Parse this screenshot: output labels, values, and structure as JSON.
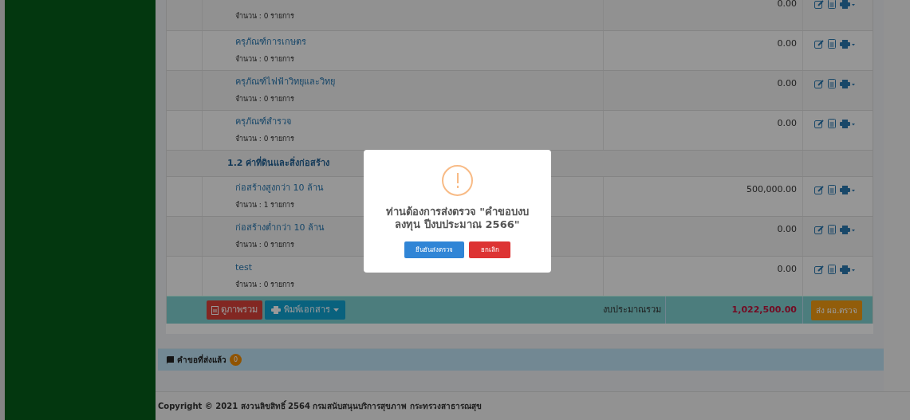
{
  "rows": [
    {
      "kind": "item",
      "count": "จำนวน : 0 รายการ",
      "amount": "0.00"
    },
    {
      "kind": "item",
      "title": "ครุภัณฑ์การเกษตร",
      "count": "จำนวน : 0 รายการ",
      "amount": "0.00"
    },
    {
      "kind": "item",
      "title": "ครุภัณฑ์ไฟฟ้าวิทยุและวิทยุ",
      "count": "จำนวน : 0 รายการ",
      "amount": "0.00"
    },
    {
      "kind": "item",
      "title": "ครุภัณฑ์สำรวจ",
      "count": "จำนวน : 0 รายการ",
      "amount": "0.00"
    },
    {
      "kind": "section",
      "title": "1.2 ค่าที่ดินและสิ่งก่อสร้าง"
    },
    {
      "kind": "item",
      "title": "ก่อสร้างสูงกว่า 10 ล้าน",
      "count": "จำนวน : 1 รายการ",
      "amount": "500,000.00"
    },
    {
      "kind": "item",
      "title": "ก่อสร้างต่ำกว่า 10 ล้าน",
      "count": "จำนวน : 0 รายการ",
      "amount": "0.00"
    },
    {
      "kind": "item",
      "title": "test",
      "count": "จำนวน : 0 รายการ",
      "amount": "0.00"
    }
  ],
  "total": {
    "overview_button": "ดูภาพรวม",
    "print_button": "พิมพ์เอกสาร",
    "label": "งบประมาณรวม",
    "amount": "1,022,500.00",
    "send_button": "ส่ง ผอ.ตรวจ"
  },
  "sent_panel": {
    "title": "คำขอที่ส่งแล้ว",
    "badge": "0"
  },
  "footer": {
    "text": "Copyright © 2021 **สงวนลิขสิทธิ์** 2564 **กรมสนับสนุนบริการสุขภาพ กระทรวงสาธารณสุข**"
  },
  "dialog": {
    "message": "ท่านต้องการส่งตรวจ \"คำขอบงบลงทุน ปีงบประมาณ 2566\"",
    "confirm": "ยืนยันส่งตรวจ",
    "cancel": "ยกเลิก"
  }
}
